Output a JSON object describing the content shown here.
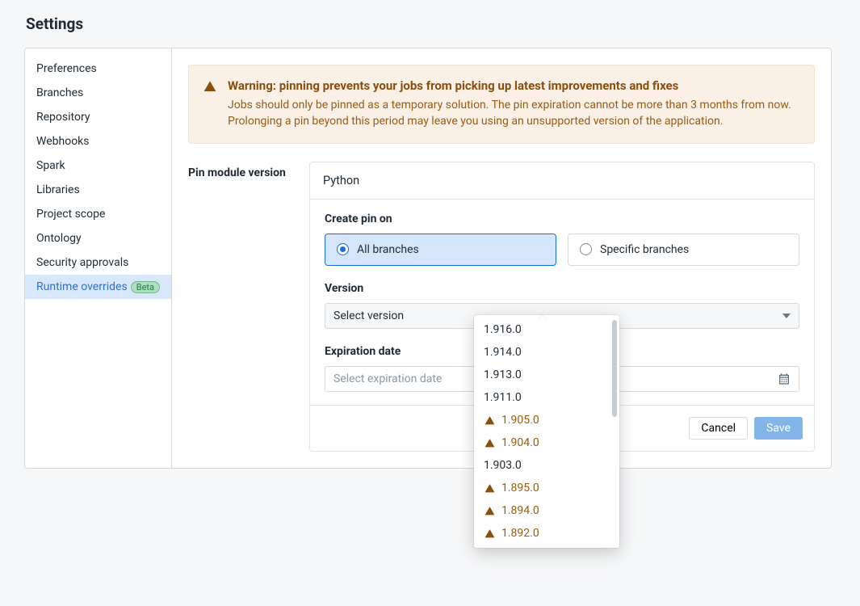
{
  "title": "Settings",
  "sidebar": {
    "items": [
      {
        "label": "Preferences"
      },
      {
        "label": "Branches"
      },
      {
        "label": "Repository"
      },
      {
        "label": "Webhooks"
      },
      {
        "label": "Spark"
      },
      {
        "label": "Libraries"
      },
      {
        "label": "Project scope"
      },
      {
        "label": "Ontology"
      },
      {
        "label": "Security approvals"
      },
      {
        "label": "Runtime overrides",
        "badge": "Beta",
        "active": true
      }
    ]
  },
  "alert": {
    "heading": "Warning: pinning prevents your jobs from picking up latest improvements and fixes",
    "body": "Jobs should only be pinned as a temporary solution. The pin expiration cannot be more than 3 months from now. Prolonging a pin beyond this period may leave you using an unsupported version of the application."
  },
  "form": {
    "section_label": "Pin module version",
    "module": "Python",
    "create_pin_label": "Create pin on",
    "branch_options": {
      "all": "All branches",
      "specific": "Specific branches",
      "selected": "all"
    },
    "version_label": "Version",
    "version_placeholder": "Select version",
    "expiration_label": "Expiration date",
    "expiration_placeholder": "Select expiration date",
    "buttons": {
      "cancel": "Cancel",
      "save": "Save"
    }
  },
  "version_dropdown": {
    "options": [
      {
        "value": "1.916.0",
        "warn": false
      },
      {
        "value": "1.914.0",
        "warn": false
      },
      {
        "value": "1.913.0",
        "warn": false
      },
      {
        "value": "1.911.0",
        "warn": false
      },
      {
        "value": "1.905.0",
        "warn": true
      },
      {
        "value": "1.904.0",
        "warn": true
      },
      {
        "value": "1.903.0",
        "warn": false
      },
      {
        "value": "1.895.0",
        "warn": true
      },
      {
        "value": "1.894.0",
        "warn": true
      },
      {
        "value": "1.892.0",
        "warn": true
      }
    ]
  }
}
